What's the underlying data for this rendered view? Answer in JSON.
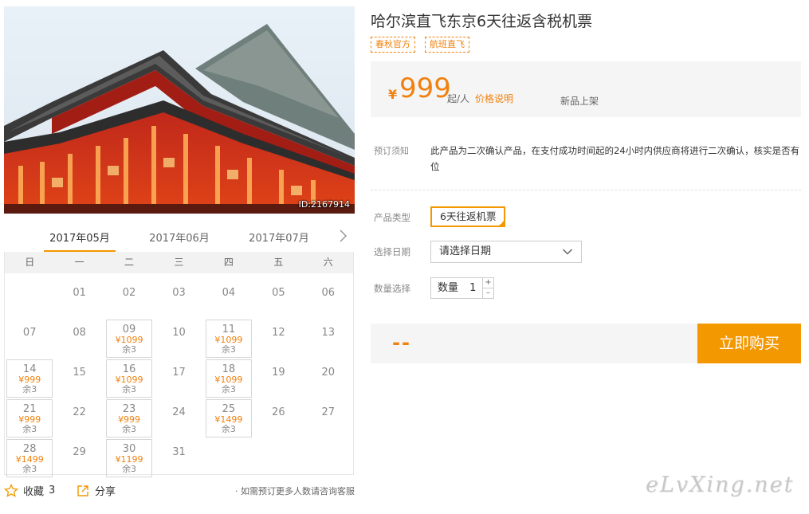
{
  "photo": {
    "id_label": "ID:2167914"
  },
  "months": {
    "tabs": [
      {
        "label": "2017年05月",
        "active": true
      },
      {
        "label": "2017年06月",
        "active": false
      },
      {
        "label": "2017年07月",
        "active": false
      }
    ]
  },
  "calendar": {
    "weekdays": [
      "日",
      "一",
      "二",
      "三",
      "四",
      "五",
      "六"
    ],
    "first_weekday": 1,
    "days": [
      {
        "d": "01"
      },
      {
        "d": "02"
      },
      {
        "d": "03"
      },
      {
        "d": "04"
      },
      {
        "d": "05"
      },
      {
        "d": "06"
      },
      {
        "d": "07"
      },
      {
        "d": "08"
      },
      {
        "d": "09",
        "price": "¥1099",
        "stock": "余3"
      },
      {
        "d": "10"
      },
      {
        "d": "11",
        "price": "¥1099",
        "stock": "余3"
      },
      {
        "d": "12"
      },
      {
        "d": "13"
      },
      {
        "d": "14",
        "price": "¥999",
        "stock": "余3"
      },
      {
        "d": "15"
      },
      {
        "d": "16",
        "price": "¥1099",
        "stock": "余3"
      },
      {
        "d": "17"
      },
      {
        "d": "18",
        "price": "¥1099",
        "stock": "余3"
      },
      {
        "d": "19"
      },
      {
        "d": "20"
      },
      {
        "d": "21",
        "price": "¥999",
        "stock": "余3"
      },
      {
        "d": "22"
      },
      {
        "d": "23",
        "price": "¥999",
        "stock": "余3"
      },
      {
        "d": "24"
      },
      {
        "d": "25",
        "price": "¥1499",
        "stock": "余3"
      },
      {
        "d": "26"
      },
      {
        "d": "27"
      },
      {
        "d": "28",
        "price": "¥1499",
        "stock": "余3"
      },
      {
        "d": "29"
      },
      {
        "d": "30",
        "price": "¥1199",
        "stock": "余3"
      },
      {
        "d": "31"
      }
    ]
  },
  "actions": {
    "favorite_label": "收藏",
    "favorite_count": "3",
    "share_label": "分享",
    "contact_note": "· 如需预订更多人数请咨询客服"
  },
  "product": {
    "title": "哈尔滨直飞东京6天往返含税机票",
    "tags": [
      "春秋官方",
      "航班直飞"
    ],
    "price_symbol": "¥",
    "price": "999",
    "price_unit": "起/人",
    "price_note": "价格说明",
    "new_label": "新品上架",
    "notice_label": "预订须知",
    "notice_text": "此产品为二次确认产品，在支付成功时间起的24小时内供应商将进行二次确认，核实是否有位",
    "type_label": "产品类型",
    "type_option": "6天往返机票",
    "date_label": "选择日期",
    "date_placeholder": "请选择日期",
    "qty_label": "数量选择",
    "qty_prefix": "数量",
    "qty_value": "1",
    "total": "--",
    "buy_label": "立即购买"
  },
  "watermark": "eLvXing.net",
  "colors": {
    "accent": "#f39800",
    "price": "#f0810f"
  }
}
